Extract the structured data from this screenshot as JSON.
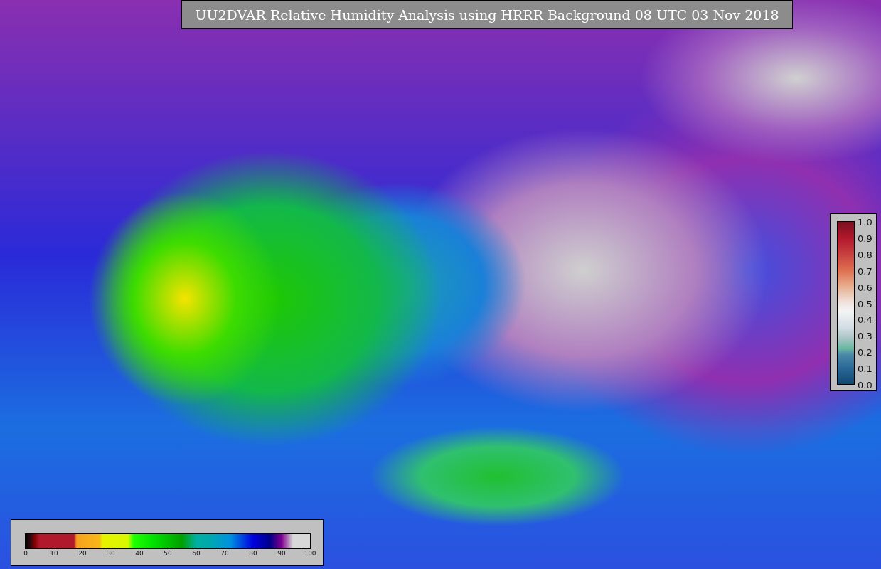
{
  "title": "UU2DVAR Relative Humidity Analysis using HRRR Background 08 UTC 03 Nov 2018",
  "colorbar_bottom": {
    "ticks": [
      "0",
      "10",
      "20",
      "30",
      "40",
      "50",
      "60",
      "70",
      "80",
      "90",
      "100"
    ]
  },
  "colorbar_right": {
    "ticks": [
      "1.0",
      "0.9",
      "0.8",
      "0.7",
      "0.6",
      "0.5",
      "0.4",
      "0.3",
      "0.2",
      "0.1",
      "0.0"
    ]
  }
}
